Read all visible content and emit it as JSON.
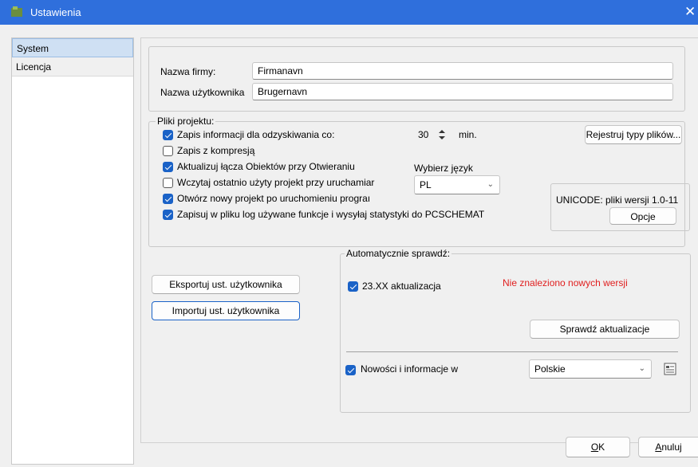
{
  "window": {
    "title": "Ustawienia",
    "close_glyph": "✕"
  },
  "nav": {
    "items": [
      "System",
      "Licencja"
    ]
  },
  "company": {
    "firm_label": "Nazwa firmy:",
    "firm_value": "Firmanavn",
    "user_label": "Nazwa użytkownika",
    "user_value": "Brugernavn"
  },
  "project": {
    "title": "Pliki projektu:",
    "recovery_label": "Zapis informacji dla odzyskiwania co:",
    "recovery_checked": true,
    "recovery_value": "30",
    "recovery_unit": "min.",
    "register_button": "Rejestruj typy plików...",
    "compress_label": "Zapis z kompresją",
    "compress_checked": false,
    "links_label": "Aktualizuj łącza Obiektów przy Otwieraniu",
    "links_checked": true,
    "language_label": "Wybierz język",
    "last_project_label": "Wczytaj ostatnio użyty projekt przy uruchamiar",
    "last_project_checked": false,
    "language_value": "PL",
    "new_project_label": "Otwórz nowy projekt po uruchomieniu prograı",
    "new_project_checked": true,
    "log_label": "Zapisuj w pliku log używane funkcje i wysyłaj statystyki do PCSCHEMAT",
    "log_checked": true,
    "unicode_label": "UNICODE: pliki wersji 1.0-11",
    "options_button": "Opcje"
  },
  "user_settings": {
    "export_button": "Eksportuj ust. użytkownika",
    "import_button": "Importuj ust. użytkownika"
  },
  "updates": {
    "title": "Automatycznie sprawdź:",
    "update_label": "23.XX aktualizacja",
    "update_checked": true,
    "status": "Nie znaleziono nowych wersji",
    "check_button": "Sprawdź aktualizacje",
    "news_label": "Nowości i informacje w",
    "news_checked": true,
    "news_language": "Polskie"
  },
  "footer": {
    "ok_accel": "O",
    "ok_rest": "K",
    "cancel_accel": "A",
    "cancel_rest": "nuluj"
  },
  "colors": {
    "titlebar": "#2f6fdc",
    "accent": "#1a62c7",
    "status": "#e01e1e"
  }
}
